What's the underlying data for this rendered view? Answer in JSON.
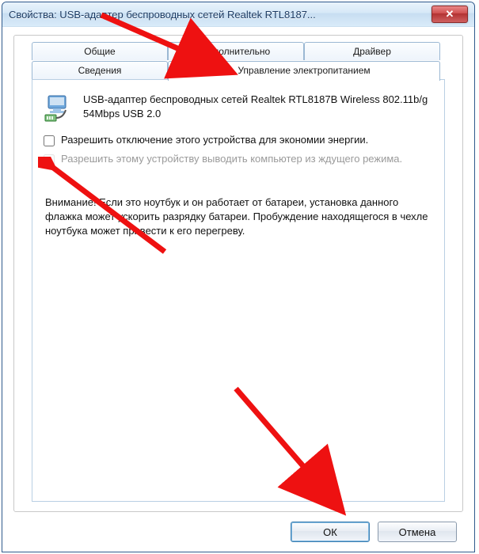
{
  "window": {
    "title": "Свойства: USB-адаптер беспроводных сетей Realtek RTL8187..."
  },
  "tabs": {
    "general": "Общие",
    "advanced": "Дополнительно",
    "driver": "Драйвер",
    "details": "Сведения",
    "power": "Управление электропитанием"
  },
  "device": {
    "name": "USB-адаптер беспроводных сетей Realtek RTL8187B Wireless 802.11b/g 54Mbps USB 2.0"
  },
  "options": {
    "allow_off": "Разрешить отключение этого устройства для экономии энергии.",
    "allow_wake": "Разрешить этому устройству выводить компьютер из ждущего режима."
  },
  "warning": "Внимание! Если это ноутбук и он работает от батареи, установка данного флажка может ускорить разрядку батареи. Пробуждение находящегося в чехле ноутбука может привести к его перегреву.",
  "buttons": {
    "ok": "ОК",
    "cancel": "Отмена"
  }
}
